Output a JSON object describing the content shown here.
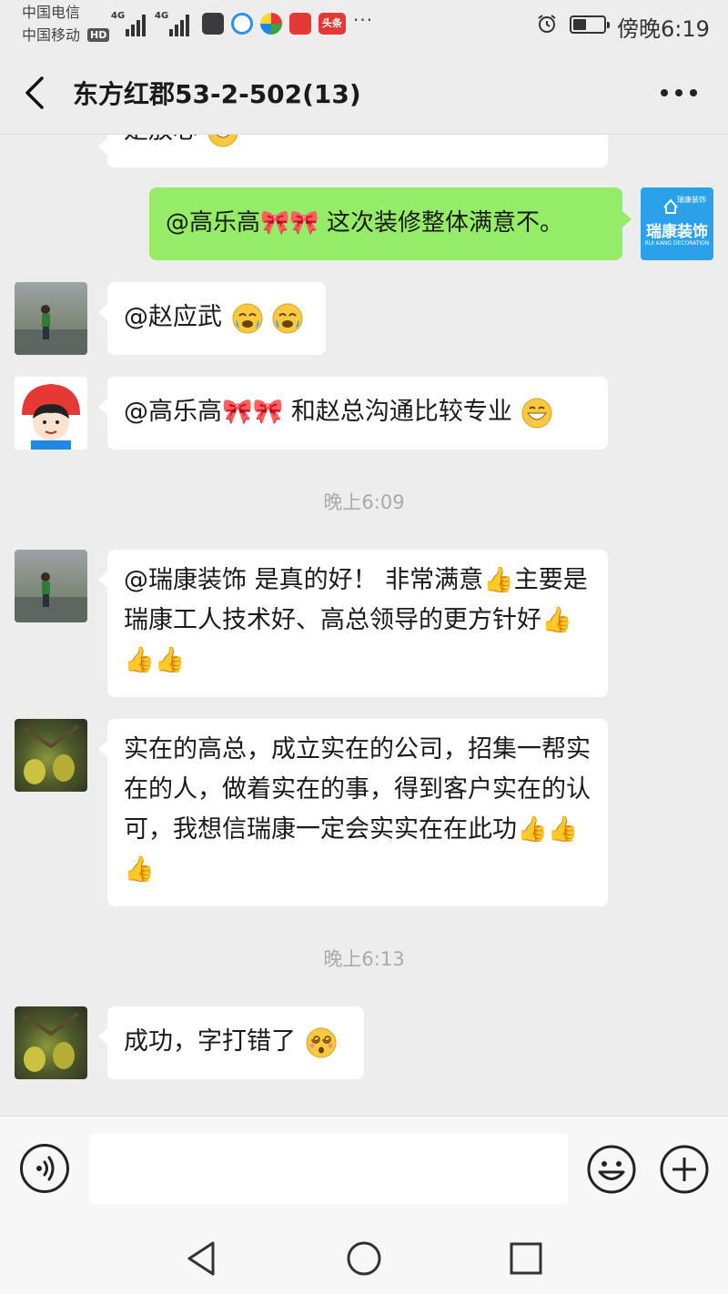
{
  "status_bar": {
    "carrier_1": "中国电信",
    "carrier_2": "中国移动",
    "hd_badge": "HD",
    "network_1": "4G",
    "network_2": "4G",
    "more_indicator": "···",
    "time": "傍晚6:19"
  },
  "header": {
    "title": "东方红郡53-2-502(13)"
  },
  "messages": [
    {
      "side": "left",
      "text": "是放心",
      "emoji": "grin-emoji"
    },
    {
      "side": "right",
      "sender": "瑞康装饰",
      "text": "@高乐高🎀🎀 这次装修整体满意不。"
    },
    {
      "side": "left",
      "text": "@赵应武 ",
      "emoji": "crying-emoji"
    },
    {
      "side": "left",
      "text": "@高乐高🎀🎀 和赵总沟通比较专业",
      "emoji": "grin-emoji"
    },
    {
      "side": "left",
      "text": "@瑞康装饰 是真的好！ 非常满意👍主要是瑞康工人技术好、高总领导的更方针好👍👍👍"
    },
    {
      "side": "left",
      "text": "实在的高总，成立实在的公司，招集一帮实在的人，做着实在的事，得到客户实在的认可，我想信瑞康一定会实实在在此功👍👍👍"
    },
    {
      "side": "left",
      "text": "成功，字打错了",
      "emoji": "dizzy-emoji"
    }
  ],
  "timestamps": [
    "晚上6:09",
    "晚上6:13"
  ],
  "avatar_logo": {
    "top_text": "瑞康装饰",
    "name": "瑞康装饰",
    "sub": "RUI KANG DECORATION"
  },
  "input_bar": {
    "placeholder": ""
  },
  "colors": {
    "background": "#ededed",
    "self_bubble": "#95ec69",
    "other_bubble": "#ffffff",
    "brand_blue": "#2aa1e8"
  }
}
